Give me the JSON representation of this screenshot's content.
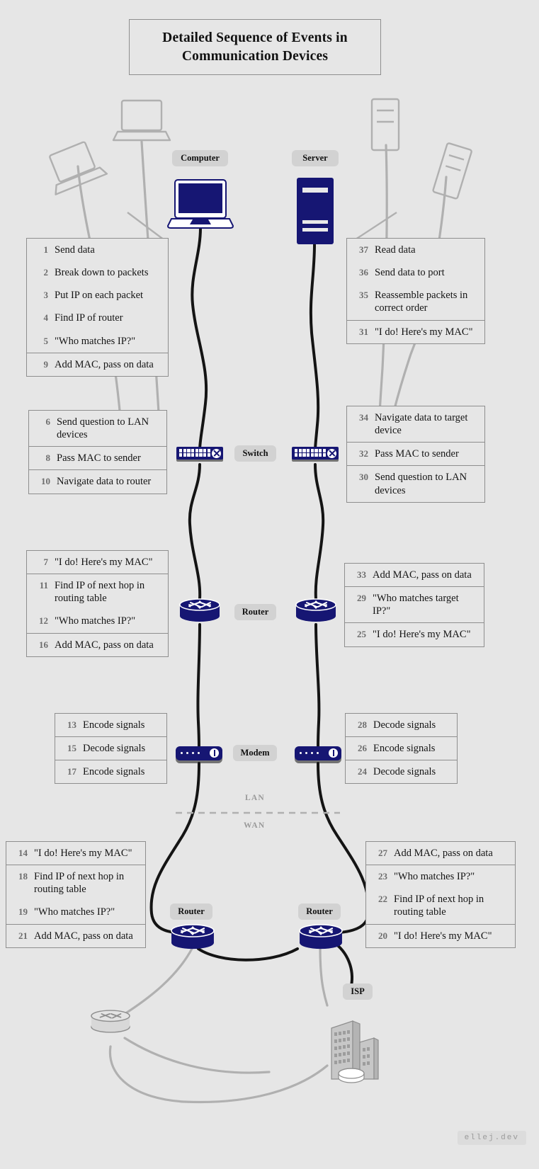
{
  "title": "Detailed Sequence of Events in Communication Devices",
  "watermark": "ellej.dev",
  "zones": {
    "lan": "LAN",
    "wan": "WAN"
  },
  "devices": {
    "computer": "Computer",
    "server": "Server",
    "switch": "Switch",
    "router": "Router",
    "modem": "Modem",
    "wan_router_left": "Router",
    "wan_router_right": "Router",
    "isp": "ISP"
  },
  "colors": {
    "background": "#e6e6e6",
    "device_navy": "#161673",
    "chip_gray": "#d2d2d2",
    "box_border": "#8e8e8e",
    "step_number": "#6d6d6d",
    "cable_lan": "#141414",
    "cable_decor": "#b0b0b0",
    "zone_label": "#9a9a9a"
  },
  "left_boxes": [
    {
      "id": "computer-steps",
      "groups": [
        {
          "steps": [
            {
              "n": "1",
              "t": "Send data"
            },
            {
              "n": "2",
              "t": "Break down to packets"
            },
            {
              "n": "3",
              "t": "Put IP on each packet"
            },
            {
              "n": "4",
              "t": "Find IP of router"
            },
            {
              "n": "5",
              "t": "\"Who matches IP?\""
            }
          ]
        },
        {
          "steps": [
            {
              "n": "9",
              "t": "Add MAC, pass on data"
            }
          ]
        }
      ]
    },
    {
      "id": "switch-steps-left",
      "groups": [
        {
          "steps": [
            {
              "n": "6",
              "t": "Send question to LAN devices"
            }
          ]
        },
        {
          "steps": [
            {
              "n": "8",
              "t": "Pass MAC to sender"
            }
          ]
        },
        {
          "steps": [
            {
              "n": "10",
              "t": "Navigate data to router"
            }
          ]
        }
      ]
    },
    {
      "id": "router-steps-left",
      "groups": [
        {
          "steps": [
            {
              "n": "7",
              "t": "\"I do! Here's my MAC\""
            }
          ]
        },
        {
          "steps": [
            {
              "n": "11",
              "t": "Find IP of next hop in routing table"
            },
            {
              "n": "12",
              "t": "\"Who matches IP?\""
            }
          ]
        },
        {
          "steps": [
            {
              "n": "16",
              "t": "Add MAC, pass on data"
            }
          ]
        }
      ]
    },
    {
      "id": "modem-steps-left",
      "groups": [
        {
          "steps": [
            {
              "n": "13",
              "t": "Encode signals"
            }
          ]
        },
        {
          "steps": [
            {
              "n": "15",
              "t": "Decode signals"
            }
          ]
        },
        {
          "steps": [
            {
              "n": "17",
              "t": "Encode signals"
            }
          ]
        }
      ]
    },
    {
      "id": "wan-router-steps-left",
      "groups": [
        {
          "steps": [
            {
              "n": "14",
              "t": "\"I do! Here's my MAC\""
            }
          ]
        },
        {
          "steps": [
            {
              "n": "18",
              "t": "Find IP of next hop in routing table"
            },
            {
              "n": "19",
              "t": "\"Who matches IP?\""
            }
          ]
        },
        {
          "steps": [
            {
              "n": "21",
              "t": "Add MAC, pass on data"
            }
          ]
        }
      ]
    }
  ],
  "right_boxes": [
    {
      "id": "server-steps",
      "groups": [
        {
          "steps": [
            {
              "n": "37",
              "t": "Read data"
            },
            {
              "n": "36",
              "t": "Send data to port"
            },
            {
              "n": "35",
              "t": "Reassemble packets in correct order"
            }
          ]
        },
        {
          "steps": [
            {
              "n": "31",
              "t": "\"I do! Here's my MAC\""
            }
          ]
        }
      ]
    },
    {
      "id": "switch-steps-right",
      "groups": [
        {
          "steps": [
            {
              "n": "34",
              "t": "Navigate data to target device"
            }
          ]
        },
        {
          "steps": [
            {
              "n": "32",
              "t": "Pass MAC to sender"
            }
          ]
        },
        {
          "steps": [
            {
              "n": "30",
              "t": "Send question to LAN devices"
            }
          ]
        }
      ]
    },
    {
      "id": "router-steps-right",
      "groups": [
        {
          "steps": [
            {
              "n": "33",
              "t": "Add MAC, pass on data"
            }
          ]
        },
        {
          "steps": [
            {
              "n": "29",
              "t": "\"Who matches target IP?\""
            }
          ]
        },
        {
          "steps": [
            {
              "n": "25",
              "t": "\"I do! Here's my MAC\""
            }
          ]
        }
      ]
    },
    {
      "id": "modem-steps-right",
      "groups": [
        {
          "steps": [
            {
              "n": "28",
              "t": "Decode signals"
            }
          ]
        },
        {
          "steps": [
            {
              "n": "26",
              "t": "Encode signals"
            }
          ]
        },
        {
          "steps": [
            {
              "n": "24",
              "t": "Decode signals"
            }
          ]
        }
      ]
    },
    {
      "id": "wan-router-steps-right",
      "groups": [
        {
          "steps": [
            {
              "n": "27",
              "t": "Add MAC, pass on data"
            }
          ]
        },
        {
          "steps": [
            {
              "n": "23",
              "t": "\"Who matches IP?\""
            },
            {
              "n": "22",
              "t": "Find IP of next hop in routing table"
            }
          ]
        },
        {
          "steps": [
            {
              "n": "20",
              "t": "\"I do! Here's my MAC\""
            }
          ]
        }
      ]
    }
  ]
}
